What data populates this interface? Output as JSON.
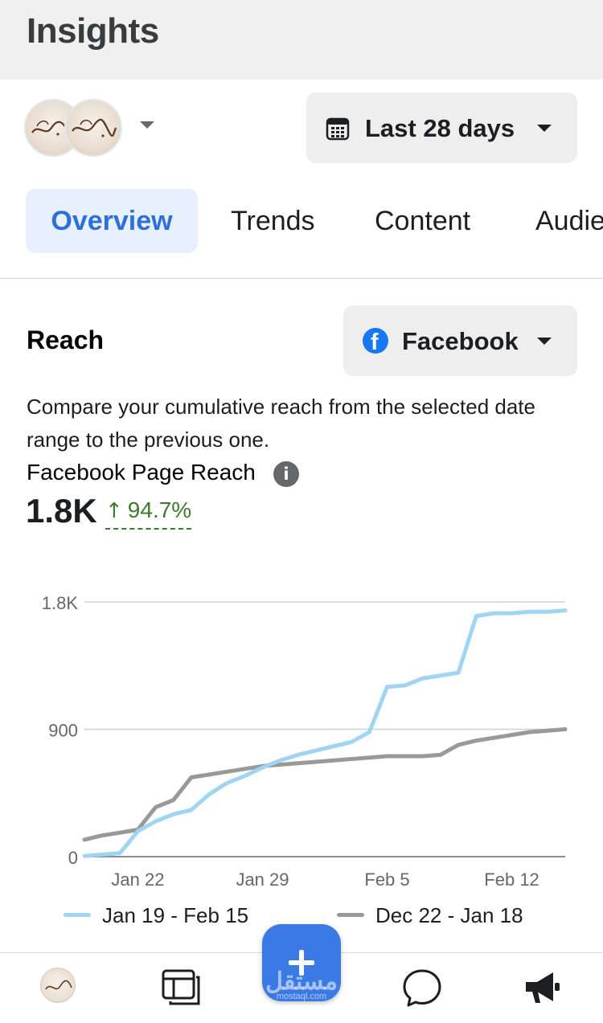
{
  "header": {
    "title": "Insights"
  },
  "account": {
    "name": "Page avatar"
  },
  "date_range": {
    "label": "Last 28 days"
  },
  "tabs": [
    {
      "label": "Overview",
      "active": true
    },
    {
      "label": "Trends"
    },
    {
      "label": "Content"
    },
    {
      "label": "Audie"
    }
  ],
  "reach": {
    "title": "Reach",
    "platform": "Facebook",
    "description": "Compare your cumulative reach from the selected date range to the previous one.",
    "metric_label": "Facebook Page Reach",
    "metric_value": "1.8K",
    "metric_change": "94.7%"
  },
  "chart_data": {
    "type": "line",
    "ylim": [
      0,
      1800
    ],
    "y_ticks": [
      "0",
      "900",
      "1.8K"
    ],
    "x_ticks": [
      "Jan 22",
      "Jan 29",
      "Feb 5",
      "Feb 12"
    ],
    "x_tick_days": [
      3,
      10,
      17,
      24
    ],
    "grid": true,
    "legend": "bottom",
    "series": [
      {
        "name": "Jan 19 - Feb 15",
        "color": "#9fd4f3",
        "values": [
          5,
          15,
          25,
          180,
          250,
          300,
          330,
          440,
          520,
          570,
          630,
          680,
          720,
          750,
          780,
          810,
          880,
          1200,
          1210,
          1260,
          1280,
          1300,
          1700,
          1720,
          1720,
          1730,
          1730,
          1740
        ]
      },
      {
        "name": "Dec 22 - Jan 18",
        "color": "#999999",
        "values": [
          120,
          150,
          170,
          190,
          350,
          400,
          560,
          580,
          600,
          620,
          640,
          650,
          660,
          670,
          680,
          690,
          700,
          710,
          710,
          710,
          720,
          790,
          820,
          840,
          860,
          880,
          890,
          900
        ]
      }
    ]
  },
  "colors": {
    "accent": "#2f6fdc",
    "positive": "#3d7a2e",
    "fab": "#3b7ae4"
  },
  "watermark": {
    "arabic": "مستقل",
    "latin": "mostaql.com"
  },
  "nav": {
    "items": [
      "avatar",
      "pages-icon",
      "create-button",
      "messages-icon",
      "megaphone-icon"
    ]
  }
}
